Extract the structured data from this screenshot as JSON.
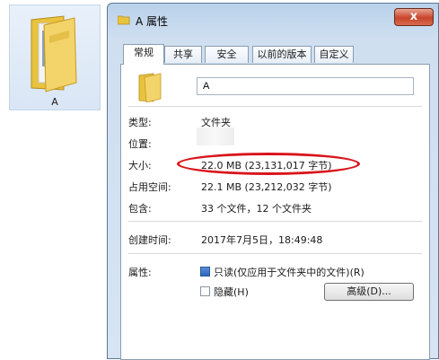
{
  "desktop": {
    "folder_label": "A"
  },
  "window": {
    "title": "A 属性",
    "close_label": "x",
    "tabs": [
      "常规",
      "共享",
      "安全",
      "以前的版本",
      "自定义"
    ],
    "general": {
      "name_value": "A",
      "type": {
        "label": "类型:",
        "value": "文件夹"
      },
      "location": {
        "label": "位置:",
        "value": ""
      },
      "size": {
        "label": "大小:",
        "value": "22.0 MB (23,131,017 字节)"
      },
      "disk_size": {
        "label": "占用空间:",
        "value": "22.1 MB (23,212,032 字节)"
      },
      "contains": {
        "label": "包含:",
        "value": "33 个文件，12 个文件夹"
      },
      "created": {
        "label": "创建时间:",
        "value": "2017年7月5日，18:49:48"
      },
      "attributes": {
        "label": "属性:",
        "readonly_label": "只读(仅应用于文件夹中的文件)(R)",
        "readonly_checked": true,
        "hidden_label": "隐藏(H)",
        "hidden_checked": false,
        "advanced_button": "高级(D)..."
      }
    }
  },
  "colors": {
    "highlight_ring": "#d9141a",
    "accent": "#2c66bf",
    "close": "#c7452a"
  }
}
